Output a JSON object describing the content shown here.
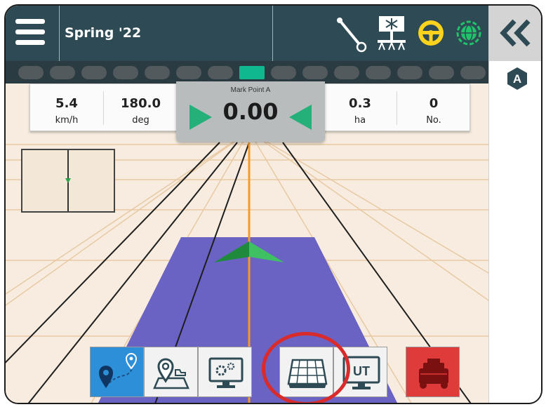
{
  "header": {
    "job_name": "Spring '22",
    "status_icons": [
      "implement-hitch-icon",
      "boom-sections-icon",
      "steering-wheel-icon",
      "gnss-globe-icon"
    ],
    "menu_icon": "hamburger-menu-icon"
  },
  "side_panel": {
    "collapse_icon": "double-chevron-left-icon",
    "mode_badge": "A"
  },
  "boom_sections": {
    "count": 14,
    "active_index": 7
  },
  "readouts": {
    "speed": {
      "value": "5.4",
      "unit": "km/h"
    },
    "heading": {
      "value": "180.0",
      "unit": "deg"
    },
    "area": {
      "value": "0.3",
      "unit": "ha"
    },
    "count": {
      "value": "0",
      "unit": "No."
    }
  },
  "guidance": {
    "label": "Mark Point A",
    "cross_track": "0.00"
  },
  "toolbar": {
    "buttons": [
      {
        "name": "guidance-mode-button",
        "icon": "waypoint-path-icon",
        "active": true
      },
      {
        "name": "mapping-button",
        "icon": "map-marker-field-icon",
        "active": false
      },
      {
        "name": "console-settings-button",
        "icon": "monitor-gears-icon",
        "active": false
      },
      {
        "name": "display-view-button",
        "icon": "field-grid-view-icon",
        "active": false,
        "highlighted": true
      },
      {
        "name": "universal-terminal-button",
        "icon": "monitor-ut-icon",
        "active": false
      },
      {
        "name": "tank-vehicle-button",
        "icon": "tank-icon",
        "active": false
      }
    ],
    "ut_label": "UT"
  },
  "colors": {
    "header_bg": "#2e4a54",
    "segment_active": "#0fb88f",
    "coverage": "#6a63c4",
    "guideline": "#f39a2a",
    "arrow_green": "#25b07a",
    "highlight_ring": "#d92b2b",
    "active_tool": "#2d8fd8",
    "tank_red": "#e03b3b"
  }
}
